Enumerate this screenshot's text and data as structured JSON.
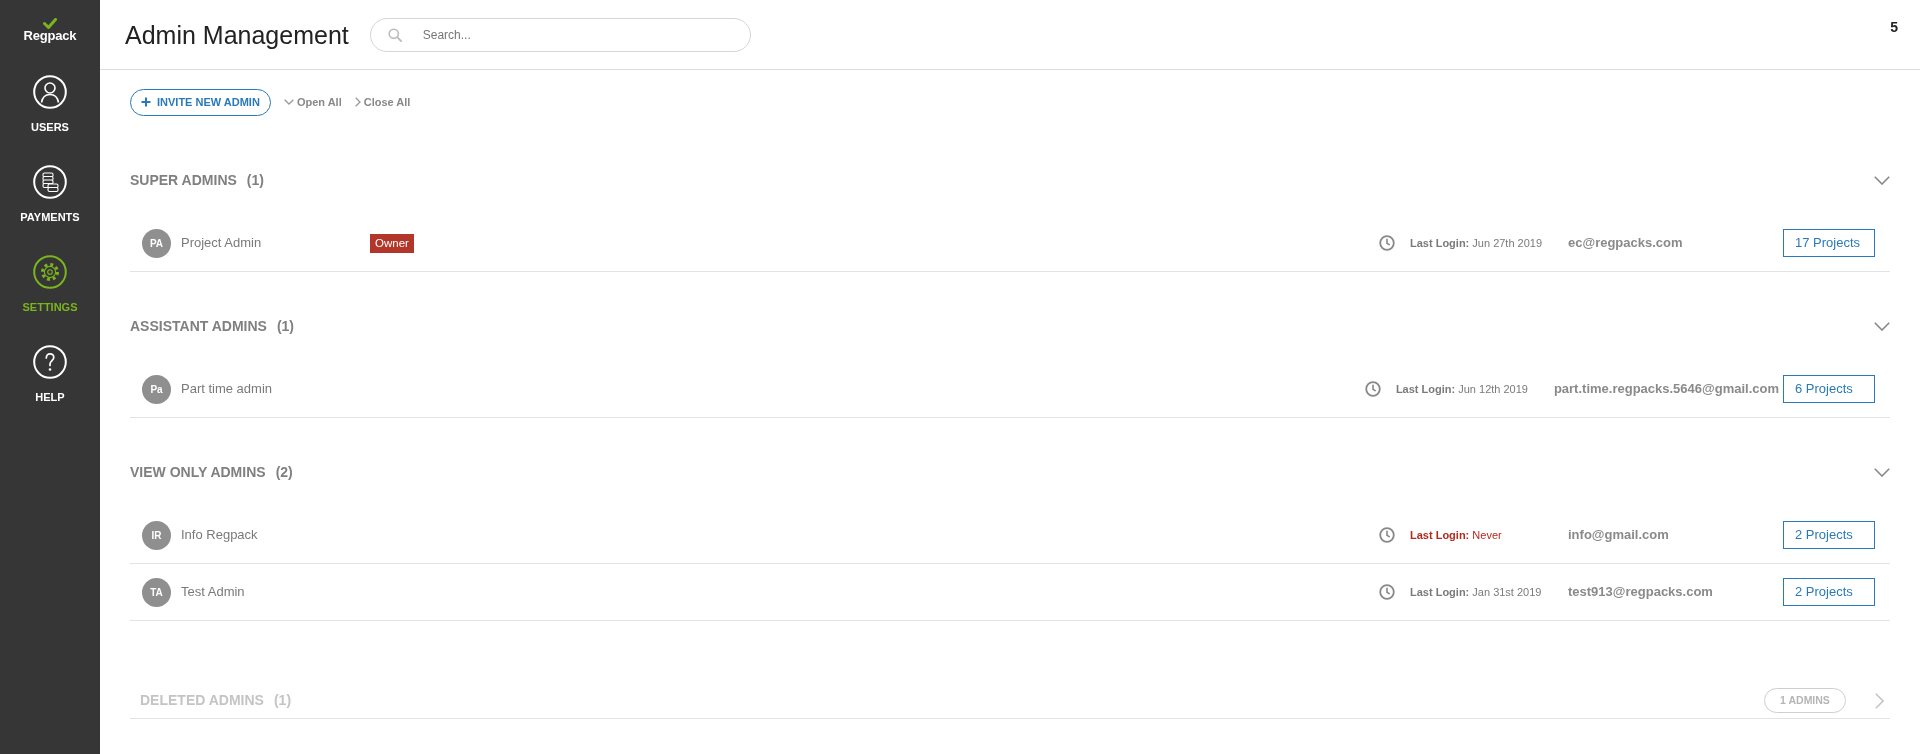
{
  "sidebar": {
    "logo": "Regpack",
    "items": [
      {
        "label": "USERS",
        "kind": "users",
        "selected": false
      },
      {
        "label": "PAYMENTS",
        "kind": "payments",
        "selected": false
      },
      {
        "label": "SETTINGS",
        "kind": "settings",
        "selected": true
      },
      {
        "label": "HELP",
        "kind": "help",
        "selected": false
      }
    ]
  },
  "header": {
    "title": "Admin Management",
    "search": {
      "placeholder": "Search..."
    },
    "counter": "5"
  },
  "toolbar": {
    "invite_button": "INVITE NEW ADMIN",
    "open_all": "Open All",
    "close_all": "Close All"
  },
  "groups": [
    {
      "title": "SUPER ADMINS",
      "count": "(1)",
      "expanded": true,
      "disabled": false,
      "admins": [
        {
          "initials": "PA",
          "name": "Project Admin",
          "badge": "Owner",
          "last_login": "**Last Login:** Jun 27th 2019",
          "alert": false,
          "email": "ec@regpacks.com",
          "projects": "17 Projects"
        }
      ]
    },
    {
      "title": "ASSISTANT ADMINS",
      "count": "(1)",
      "expanded": true,
      "disabled": false,
      "admins": [
        {
          "initials": "Pa",
          "name": "Part time admin",
          "last_login": "**Last Login:** Jun 12th 2019",
          "alert": false,
          "email": "part.time.regpacks.5646@gmail.com",
          "projects": "6 Projects"
        }
      ]
    },
    {
      "title": "VIEW ONLY ADMINS",
      "count": "(2)",
      "expanded": true,
      "disabled": false,
      "admins": [
        {
          "initials": "IR",
          "name": "Info Regpack",
          "last_login": "**Last Login:** Never",
          "alert": true,
          "email": "info@gmail.com",
          "projects": "2 Projects"
        },
        {
          "initials": "TA",
          "name": "Test Admin",
          "last_login": "**Last Login:** Jan 31st 2019",
          "alert": false,
          "email": "test913@regpacks.com",
          "projects": "2 Projects"
        }
      ]
    },
    {
      "title": "DELETED ADMINS",
      "count": "(1)",
      "expanded": false,
      "disabled": true,
      "pill": "1 ADMINS"
    }
  ]
}
